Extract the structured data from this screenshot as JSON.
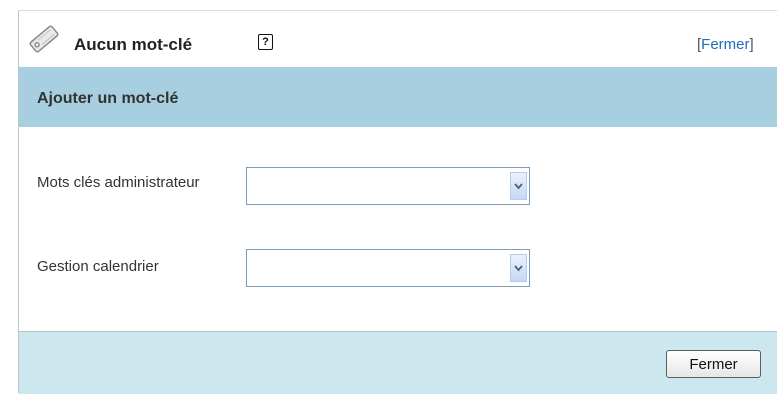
{
  "header": {
    "icon": "tag-icon",
    "title": "Aucun mot-clé",
    "help_icon": "?",
    "close_link_open": "[",
    "close_link": "Fermer",
    "close_link_close": "]"
  },
  "section": {
    "title": "Ajouter un mot-clé"
  },
  "fields": [
    {
      "label": "Mots clés administrateur",
      "value": ""
    },
    {
      "label": "Gestion calendrier",
      "value": ""
    }
  ],
  "footer": {
    "button_label": "Fermer"
  },
  "colors": {
    "section_header_bg": "#a7cfdf",
    "footer_bg": "#cde7ef",
    "link": "#1f6cbf"
  }
}
